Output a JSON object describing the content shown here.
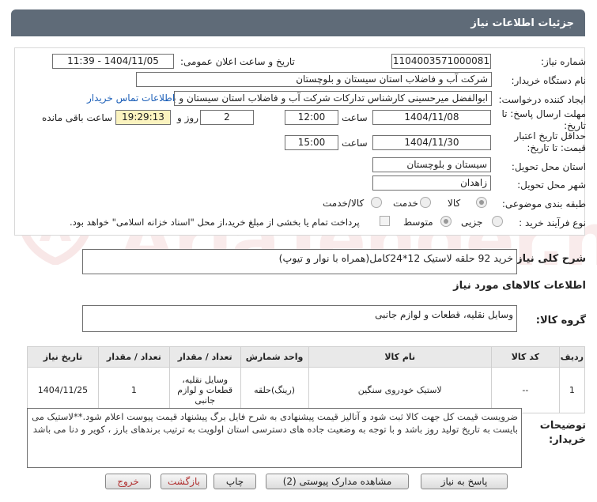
{
  "header": {
    "title": "جزئیات اطلاعات نیاز"
  },
  "watermark": {
    "brand": "AriaTender.net"
  },
  "form": {
    "need_number_label": "شماره نیاز:",
    "need_number": "1104003571000081",
    "announce_label": "تاریخ و ساعت اعلان عمومی:",
    "announce_value": "1404/11/05 - 11:39",
    "buyer_org_label": "نام دستگاه خریدار:",
    "buyer_org": "شرکت آب و فاضلاب استان سیستان و بلوچستان",
    "requester_label": "ایجاد کننده درخواست:",
    "requester": "ابوالفضل میرحسینی کارشناس تدارکات شرکت آب و فاضلاب استان سیستان و بلوچستان",
    "contact_link": "اطلاعات تماس خریدار",
    "deadline_label": "مهلت ارسال پاسخ: تا تاریخ:",
    "deadline_date": "1404/11/08",
    "time_label": "ساعت",
    "deadline_time": "12:00",
    "day_value": "2",
    "day_label": "روز و",
    "remaining_time": "19:29:13",
    "remaining_label": "ساعت باقی مانده",
    "validity_label": "حداقل تاریخ اعتبار قیمت: تا تاریخ:",
    "validity_date": "1404/11/30",
    "validity_time": "15:00",
    "province_label": "استان محل تحویل:",
    "province": "سیستان و بلوچستان",
    "city_label": "شهر محل تحویل:",
    "city": "زاهدان",
    "category_label": "طبقه بندی موضوعی:",
    "category_options": [
      "کالا",
      "خدمت",
      "کالا/خدمت"
    ],
    "process_label": "نوع فرآیند خرید :",
    "process_options": [
      "جزیی",
      "متوسط"
    ],
    "payment_note": "پرداخت تمام یا بخشی از مبلغ خرید،از محل \"اسناد خزانه اسلامی\" خواهد بود."
  },
  "summary": {
    "label": "شرح کلی نیاز:",
    "text": "خرید 92 حلقه لاستیک 12*24کامل(همراه با نوار و تیوپ)"
  },
  "goods": {
    "section_title": "اطلاعات کالاهای مورد نیاز",
    "group_label": "گروه کالا:",
    "group_value": "وسایل نقلیه، قطعات و لوازم جانبی",
    "columns": [
      "ردیف",
      "کد کالا",
      "نام کالا",
      "واحد شمارش",
      "تعداد / مقدار",
      "تاریخ نیاز"
    ],
    "rows": [
      {
        "row": "1",
        "code": "--",
        "name": "لاستیک خودروی سنگین",
        "unit_col": "وسایل نقلیه، قطعات و لوازم جانبی",
        "unit": "(رینگ)حلقه",
        "qty": "1",
        "date": "1404/11/25"
      }
    ]
  },
  "notes": {
    "label": "توضیحات خریدار:",
    "text": "ضرویست قیمت کل جهت کالا ثبت شود و آنالیز قیمت پیشنهادی به شرح فایل برگ پیشنهاد قیمت پیوست اعلام شود.**لاستیک می بایست به تاریخ تولید روز باشد و با توجه به وضعیت جاده های دسترسی استان اولویت به ترتیب برندهای بارز ، کویر و دنا می باشد"
  },
  "buttons": {
    "reply": "پاسخ به نیاز",
    "attachments": "مشاهده مدارک پیوستی (2)",
    "print": "چاپ",
    "back": "بازگشت",
    "exit": "خروج"
  },
  "colors": {
    "header": "#5f6b78",
    "remaining_bg": "#fbf3bf",
    "link": "#1c5fb8"
  }
}
